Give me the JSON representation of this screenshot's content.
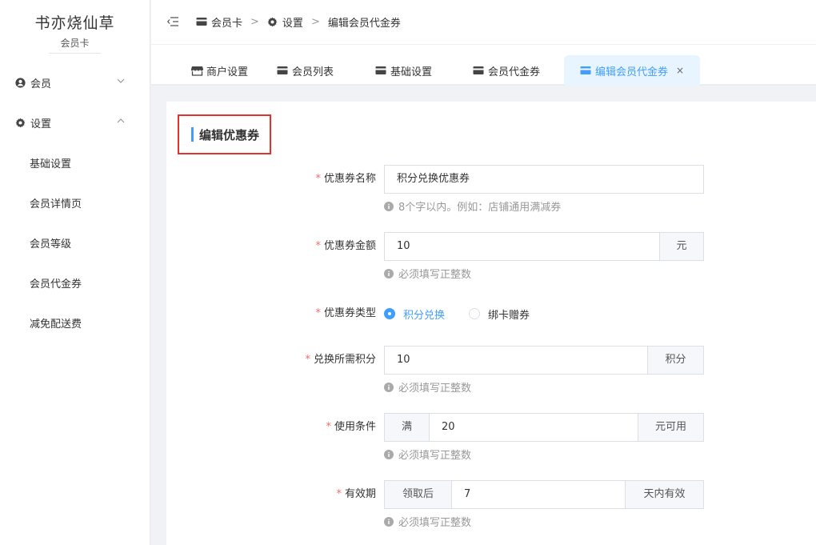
{
  "brand": {
    "title": "书亦烧仙草",
    "subtitle": "会员卡"
  },
  "sidebar": {
    "groups": [
      {
        "label": "会员",
        "icon": "user-icon",
        "expanded": false
      },
      {
        "label": "设置",
        "icon": "gear-icon",
        "expanded": true
      }
    ],
    "items": [
      {
        "label": "基础设置"
      },
      {
        "label": "会员详情页"
      },
      {
        "label": "会员等级"
      },
      {
        "label": "会员代金券"
      },
      {
        "label": "减免配送费"
      }
    ]
  },
  "breadcrumb": {
    "items": [
      "会员卡",
      "设置",
      "编辑会员代金券"
    ],
    "separator": ">"
  },
  "tabs": [
    {
      "label": "商户设置",
      "icon": "store-icon"
    },
    {
      "label": "会员列表",
      "icon": "card-icon"
    },
    {
      "label": "基础设置",
      "icon": "card-icon"
    },
    {
      "label": "会员代金券",
      "icon": "card-icon"
    },
    {
      "label": "编辑会员代金券",
      "icon": "card-icon",
      "active": true,
      "close": "×"
    }
  ],
  "form": {
    "section_title": "编辑优惠券",
    "name": {
      "label": "优惠券名称",
      "value": "积分兑换优惠券",
      "hint": "8个字以内。例如：店铺通用满减券"
    },
    "amount": {
      "label": "优惠券金额",
      "value": "10",
      "suffix": "元",
      "hint": "必须填写正整数"
    },
    "type": {
      "label": "优惠券类型",
      "options": [
        "积分兑换",
        "绑卡赠券"
      ],
      "selected": "积分兑换"
    },
    "points": {
      "label": "兑换所需积分",
      "value": "10",
      "suffix": "积分",
      "hint": "必须填写正整数"
    },
    "condition": {
      "label": "使用条件",
      "prefix": "满",
      "value": "20",
      "suffix": "元可用",
      "hint": "必须填写正整数"
    },
    "validity": {
      "label": "有效期",
      "prefix": "领取后",
      "value": "7",
      "suffix": "天内有效",
      "hint": "必须填写正整数"
    }
  },
  "colors": {
    "accent": "#409eff",
    "required": "#f56c6c",
    "highlight_border": "#e5322d"
  }
}
